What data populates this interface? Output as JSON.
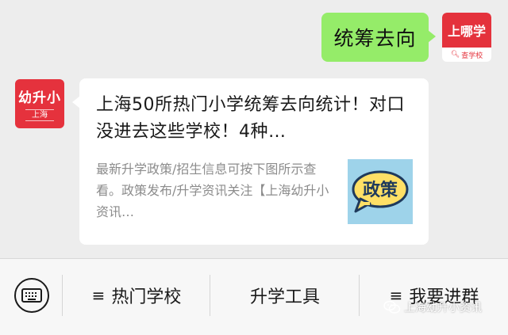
{
  "chat": {
    "outgoing": {
      "text": "统筹去向",
      "avatar": {
        "label": "上哪学",
        "sublabel": "查学校",
        "icon": "search-icon",
        "color": "#e4323c"
      }
    },
    "incoming_card": {
      "avatar": {
        "label": "幼升小",
        "sublabel": "上海",
        "color": "#e5323d"
      },
      "title": "上海50所热门小学统筹去向统计！对口没进去这些学校！4种…",
      "description": "最新升学政策/招生信息可按下图所示查看。政策发布/升学资讯关注【上海幼升小资讯…",
      "thumbnail": {
        "text": "政策",
        "icon": "speech-bubble-icon",
        "bg_color": "#9ed3ea",
        "bubble_color": "#ffe066"
      }
    }
  },
  "menubar": {
    "keyboard_icon": "keyboard-icon",
    "items": [
      {
        "label": "热门学校",
        "icon": "hamburger-icon"
      },
      {
        "label": "升学工具",
        "icon": ""
      },
      {
        "label": "我要进群",
        "icon": "hamburger-icon"
      }
    ]
  },
  "watermark": {
    "text": "上海幼升小资讯",
    "icon": "wechat-icon"
  },
  "colors": {
    "chat_bg": "#ededed",
    "outgoing_bubble": "#95ec69",
    "menubar_bg": "#f7f7f7"
  }
}
